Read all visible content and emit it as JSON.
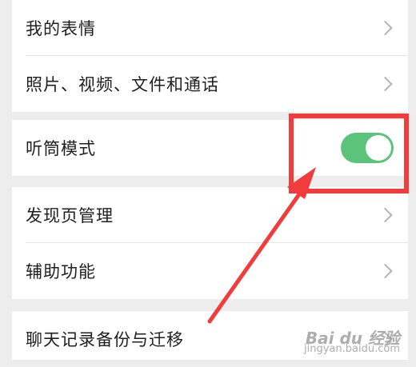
{
  "settings": {
    "items": [
      {
        "label": "我的表情",
        "control": "chevron"
      },
      {
        "label": "照片、视频、文件和通话",
        "control": "chevron"
      },
      {
        "label": "听筒模式",
        "control": "toggle",
        "toggle_on": true
      },
      {
        "label": "发现页管理",
        "control": "chevron"
      },
      {
        "label": "辅助功能",
        "control": "chevron"
      },
      {
        "label": "聊天记录备份与迁移",
        "control": "chevron"
      }
    ]
  },
  "colors": {
    "toggle_on": "#5bc47a",
    "highlight": "#f23c3c",
    "background": "#ededed"
  },
  "watermark": {
    "brand": "Bai du 经验",
    "url": "jingyan.baidu.com"
  }
}
